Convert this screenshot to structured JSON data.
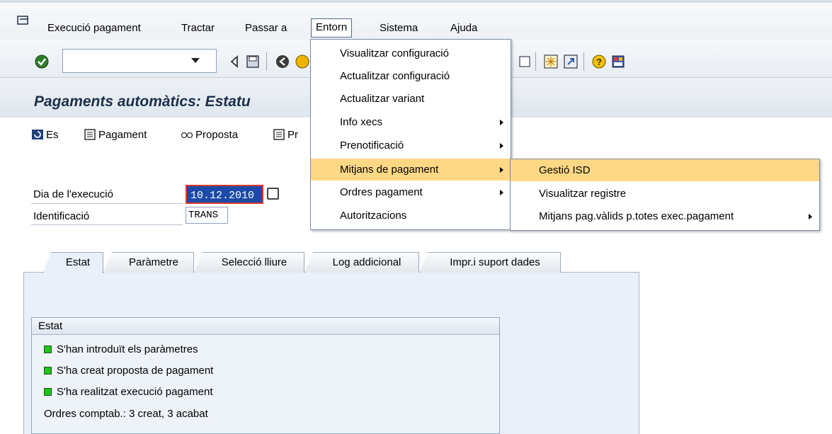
{
  "menubar": {
    "items": [
      {
        "label": "Execució pagament"
      },
      {
        "label": "Tractar"
      },
      {
        "label": "Passar a"
      },
      {
        "label": "Entorn"
      },
      {
        "label": "Sistema"
      },
      {
        "label": "Ajuda"
      }
    ]
  },
  "toolbar": {
    "command_field": ""
  },
  "title": "Pagaments automàtics: Estatu",
  "app_toolbar": {
    "items": [
      {
        "label": "Es"
      },
      {
        "label": "Pagament"
      },
      {
        "label": "Proposta"
      },
      {
        "label": "Pr"
      }
    ]
  },
  "fields": {
    "run_date_label": "Dia de l'execució",
    "run_date_value": "10.12.2010",
    "identification_label": "Identificació",
    "identification_value": "TRANS"
  },
  "tabs": [
    {
      "label": "Estat"
    },
    {
      "label": "Paràmetre"
    },
    {
      "label": "Selecció lliure"
    },
    {
      "label": "Log addicional"
    },
    {
      "label": "Impr.i suport dades"
    }
  ],
  "status_group": {
    "title": "Estat",
    "rows": [
      {
        "text": "S'han introduït els paràmetres"
      },
      {
        "text": "S'ha creat proposta de pagament"
      },
      {
        "text": "S'ha realitzat execució pagament"
      }
    ],
    "summary": "Ordres comptab.: 3 creat, 3 acabat"
  },
  "entorn_menu": {
    "items": [
      {
        "label": "Visualitzar configuració"
      },
      {
        "label": "Actualitzar configuració"
      },
      {
        "label": "Actualitzar variant"
      },
      {
        "label": "Info xecs"
      },
      {
        "label": "Prenotificació"
      },
      {
        "label": "Mitjans de pagament"
      },
      {
        "label": "Ordres pagament"
      },
      {
        "label": "Autoritzacions"
      }
    ]
  },
  "payment_methods_submenu": {
    "items": [
      {
        "label": "Gestió ISD"
      },
      {
        "label": "Visualitzar registre"
      },
      {
        "label": "Mitjans pag.vàlids p.totes exec.pagament"
      }
    ]
  },
  "colors": {
    "highlight": "#ffd886",
    "date_field_bg": "#1b4aa8",
    "status_led": "#22c21f"
  }
}
